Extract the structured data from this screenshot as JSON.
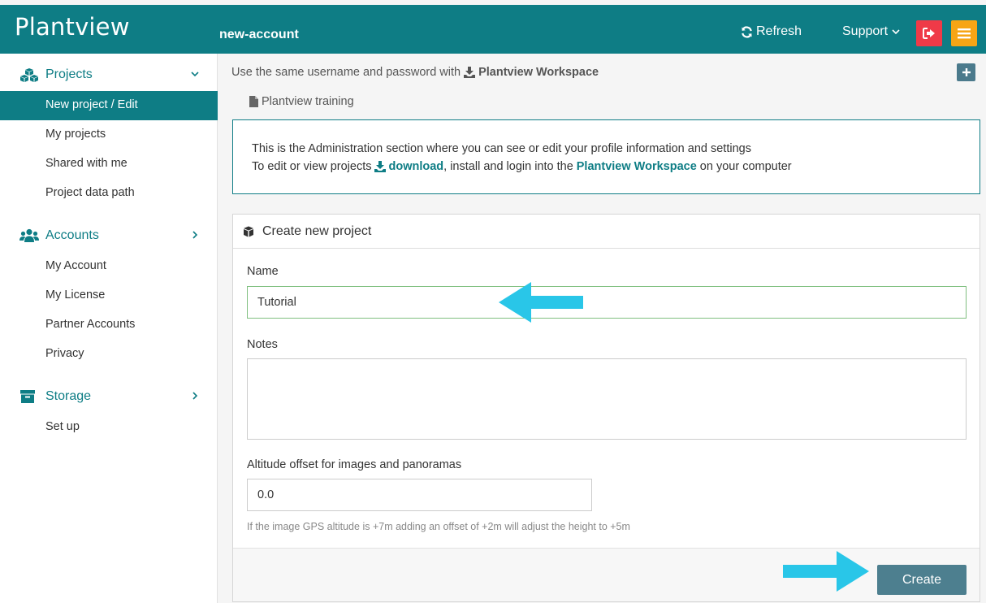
{
  "header": {
    "brand": "Plantview",
    "account_name": "new-account",
    "refresh_label": "Refresh",
    "support_label": "Support",
    "colors": {
      "bar": "#0e7d85",
      "logout": "#ef3a48",
      "menu": "#f7a515"
    }
  },
  "sidebar": {
    "sections": [
      {
        "label": "Projects",
        "icon": "cubes-icon",
        "expanded": true,
        "items": [
          {
            "label": "New project / Edit",
            "active": true
          },
          {
            "label": "My projects"
          },
          {
            "label": "Shared with me"
          },
          {
            "label": "Project data path"
          }
        ]
      },
      {
        "label": "Accounts",
        "icon": "users-icon",
        "expanded": false,
        "items": [
          {
            "label": "My Account"
          },
          {
            "label": "My License"
          },
          {
            "label": "Partner Accounts"
          },
          {
            "label": "Privacy"
          }
        ]
      },
      {
        "label": "Storage",
        "icon": "archive-icon",
        "expanded": false,
        "items": [
          {
            "label": "Set up"
          }
        ]
      }
    ]
  },
  "main": {
    "info_text": "Use the same username and password with",
    "workspace_link": "Plantview Workspace",
    "training_link": "Plantview training",
    "notice": {
      "line1": "This is the Administration section where you can see or edit your profile information and settings",
      "line2_prefix": "To edit or view projects",
      "download_link": "download",
      "line2_middle": ", install and login into the",
      "workspace_link": "Plantview Workspace",
      "line2_suffix": "on your computer"
    },
    "form": {
      "title": "Create new project",
      "name_label": "Name",
      "name_value": "Tutorial",
      "notes_label": "Notes",
      "notes_value": "",
      "altitude_label": "Altitude offset for images and panoramas",
      "altitude_value": "0.0",
      "altitude_help": "If the image GPS altitude is +7m adding an offset of +2m will adjust the height to +5m",
      "create_label": "Create"
    },
    "arrow_color": "#29c6e8"
  }
}
